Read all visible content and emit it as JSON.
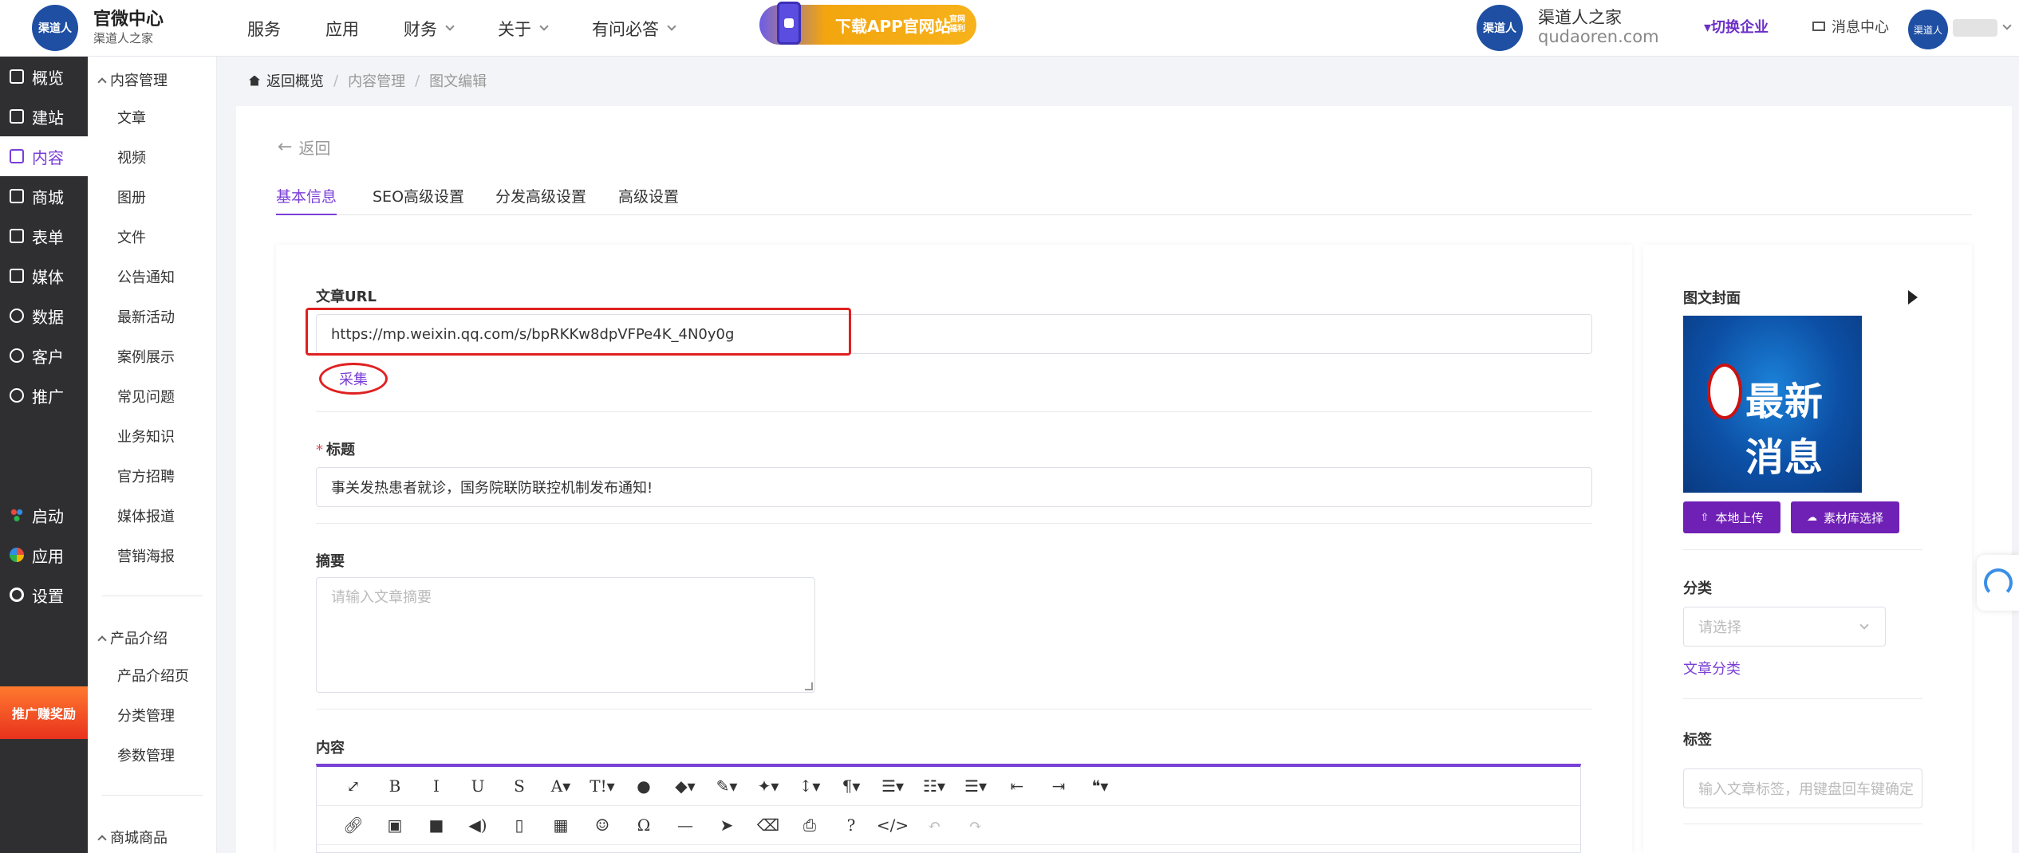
{
  "header": {
    "logo_text": "渠道人",
    "brand_title": "官微中心",
    "brand_subtitle": "渠道人之家",
    "nav": [
      {
        "label": "服务",
        "dropdown": false
      },
      {
        "label": "应用",
        "dropdown": false
      },
      {
        "label": "财务",
        "dropdown": true
      },
      {
        "label": "关于",
        "dropdown": true
      },
      {
        "label": "有问必答",
        "dropdown": true
      }
    ],
    "promo_label": "下载APP官网站",
    "promo_tag": "官网福利",
    "company_logo_text": "渠道人",
    "company_name": "渠道人之家",
    "company_domain": "qudaoren.com",
    "switch_company": "▾切换企业",
    "message_center": "消息中心",
    "user_avatar_text": "渠道人"
  },
  "main_nav": [
    {
      "label": "概览",
      "icon": "store-icon",
      "active": false
    },
    {
      "label": "建站",
      "icon": "home-icon",
      "active": false
    },
    {
      "label": "内容",
      "icon": "document-icon",
      "active": true
    },
    {
      "label": "商城",
      "icon": "cart-icon",
      "active": false
    },
    {
      "label": "表单",
      "icon": "form-icon",
      "active": false
    },
    {
      "label": "媒体",
      "icon": "video-icon",
      "active": false
    },
    {
      "label": "数据",
      "icon": "chart-icon",
      "active": false
    },
    {
      "label": "客户",
      "icon": "user-icon",
      "active": false
    },
    {
      "label": "推广",
      "icon": "link-icon",
      "active": false
    },
    {
      "label": "启动",
      "icon": "launch-icon",
      "active": false
    },
    {
      "label": "应用",
      "icon": "apps-icon",
      "active": false
    },
    {
      "label": "设置",
      "icon": "gear-icon",
      "active": false
    }
  ],
  "reward_badge": "推广赚奖励",
  "sub_nav": {
    "groups": [
      {
        "title": "内容管理",
        "items": [
          "文章",
          "视频",
          "图册",
          "文件",
          "公告通知",
          "最新活动",
          "案例展示",
          "常见问题",
          "业务知识",
          "官方招聘",
          "媒体报道",
          "营销海报"
        ]
      },
      {
        "title": "产品介绍",
        "items": [
          "产品介绍页",
          "分类管理",
          "参数管理"
        ]
      },
      {
        "title": "商城商品",
        "items": []
      }
    ]
  },
  "breadcrumb": {
    "home": "返回概览",
    "level2": "内容管理",
    "level3": "图文编辑",
    "separator": "/"
  },
  "back_label": "返回",
  "tabs": [
    {
      "label": "基本信息",
      "active": true
    },
    {
      "label": "SEO高级设置",
      "active": false
    },
    {
      "label": "分发高级设置",
      "active": false
    },
    {
      "label": "高级设置",
      "active": false
    }
  ],
  "form": {
    "url_label": "文章URL",
    "url_value": "https://mp.weixin.qq.com/s/bpRKKw8dpVFPe4K_4N0y0g",
    "collect_button": "采集",
    "title_required_mark": "*",
    "title_label": "标题",
    "title_value": "事关发热患者就诊，国务院联防联控机制发布通知!",
    "summary_label": "摘要",
    "summary_placeholder": "请输入文章摘要",
    "content_label": "内容"
  },
  "editor_toolbar": {
    "row1": [
      {
        "name": "fullscreen-icon",
        "glyph": "⤢"
      },
      {
        "name": "bold-icon",
        "glyph": "B"
      },
      {
        "name": "italic-icon",
        "glyph": "I"
      },
      {
        "name": "underline-icon",
        "glyph": "U"
      },
      {
        "name": "strikethrough-icon",
        "glyph": "S"
      },
      {
        "name": "font-color-icon",
        "glyph": "A▾"
      },
      {
        "name": "font-size-icon",
        "glyph": "T!▾"
      },
      {
        "name": "ink-drop-icon",
        "glyph": "●"
      },
      {
        "name": "tag-icon",
        "glyph": "◆▾"
      },
      {
        "name": "brush-icon",
        "glyph": "✎▾"
      },
      {
        "name": "magic-wand-icon",
        "glyph": "✦▾"
      },
      {
        "name": "line-height-icon",
        "glyph": "↕▾"
      },
      {
        "name": "paragraph-icon",
        "glyph": "¶▾"
      },
      {
        "name": "align-icon",
        "glyph": "☰▾"
      },
      {
        "name": "ordered-list-icon",
        "glyph": "☷▾"
      },
      {
        "name": "bullet-list-icon",
        "glyph": "☰▾"
      },
      {
        "name": "outdent-icon",
        "glyph": "⇤"
      },
      {
        "name": "indent-icon",
        "glyph": "⇥"
      },
      {
        "name": "quote-icon",
        "glyph": "❝▾"
      }
    ],
    "row2": [
      {
        "name": "link-icon",
        "glyph": "🔗︎"
      },
      {
        "name": "image-icon",
        "glyph": "▣"
      },
      {
        "name": "video-icon",
        "glyph": "■"
      },
      {
        "name": "audio-icon",
        "glyph": "◀)"
      },
      {
        "name": "file-icon",
        "glyph": "▯"
      },
      {
        "name": "table-icon",
        "glyph": "▦"
      },
      {
        "name": "emoji-icon",
        "glyph": "☺"
      },
      {
        "name": "omega-icon",
        "glyph": "Ω"
      },
      {
        "name": "divider-icon",
        "glyph": "—"
      },
      {
        "name": "pointer-icon",
        "glyph": "➤"
      },
      {
        "name": "eraser-icon",
        "glyph": "⌫"
      },
      {
        "name": "print-icon",
        "glyph": "⎙"
      },
      {
        "name": "help-icon",
        "glyph": "?"
      },
      {
        "name": "code-icon",
        "glyph": "</>"
      },
      {
        "name": "undo-icon",
        "glyph": "↶",
        "disabled": true
      },
      {
        "name": "redo-icon",
        "glyph": "↷",
        "disabled": true
      }
    ]
  },
  "sidebar_right": {
    "cover_label": "图文封面",
    "cover_image_text": "最新消息",
    "local_upload": "本地上传",
    "library_select": "素材库选择",
    "category_label": "分类",
    "category_placeholder": "请选择",
    "category_link": "文章分类",
    "tags_label": "标签",
    "tags_placeholder": "输入文章标签，用键盘回车键确定"
  },
  "colors": {
    "accent": "#7a3fd6",
    "button": "#7021b5",
    "annotation_red": "#e02020",
    "dark_sidebar": "#2f2f32"
  }
}
